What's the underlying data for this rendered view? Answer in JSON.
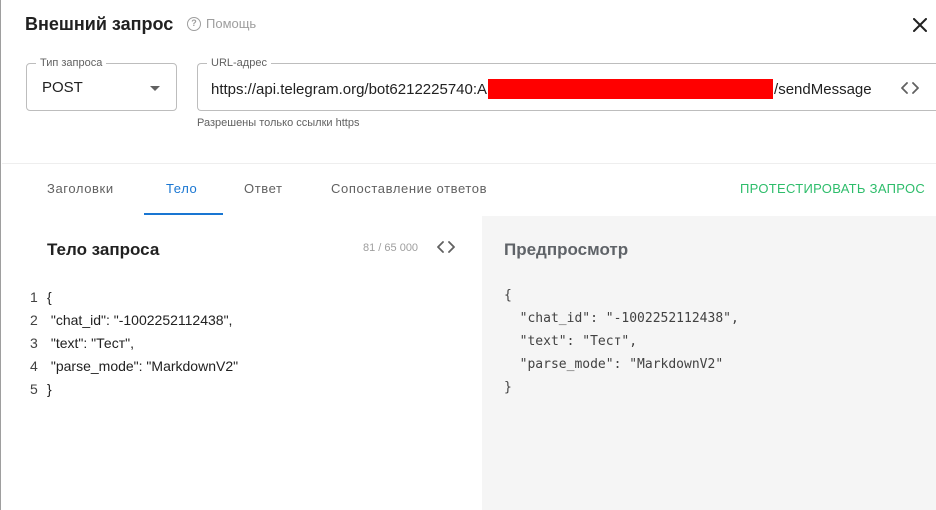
{
  "dialog": {
    "title": "Внешний запрос",
    "help_label": "Помощь",
    "help_glyph": "?"
  },
  "method_field": {
    "label": "Тип запроса",
    "value": "POST"
  },
  "url_field": {
    "label": "URL-адрес",
    "value_prefix": "https://api.telegram.org/bot6212225740:A",
    "value_suffix": "/sendMessage",
    "hint": "Разрешены только ссылки https"
  },
  "tabs": [
    {
      "label": "Заголовки",
      "active": false
    },
    {
      "label": "Тело",
      "active": true
    },
    {
      "label": "Ответ",
      "active": false
    },
    {
      "label": "Сопоставление ответов",
      "active": false
    }
  ],
  "actions": {
    "test_label": "ПРОТЕСТИРОВАТЬ ЗАПРОС"
  },
  "editor": {
    "title": "Тело запроса",
    "counter": "81 / 65 000",
    "lines": [
      {
        "num": "1",
        "text": "{"
      },
      {
        "num": "2",
        "text": " \"chat_id\": \"-1002252112438\","
      },
      {
        "num": "3",
        "text": " \"text\": \"Тест\","
      },
      {
        "num": "4",
        "text": " \"parse_mode\": \"MarkdownV2\""
      },
      {
        "num": "5",
        "text": "}"
      }
    ]
  },
  "preview": {
    "title": "Предпросмотр",
    "lines": [
      "{",
      "  \"chat_id\": \"-1002252112438\",",
      "  \"text\": \"Тест\",",
      "  \"parse_mode\": \"MarkdownV2\"",
      "}"
    ]
  },
  "colors": {
    "accent": "#1976d2",
    "test_action": "#2ebd6b",
    "redaction": "#ff0000",
    "preview_bg": "#f5f5f5"
  },
  "icons": {
    "help": "help-circle-icon",
    "close": "close-icon",
    "dropdown": "chevron-down-icon",
    "code": "code-brackets-icon"
  }
}
